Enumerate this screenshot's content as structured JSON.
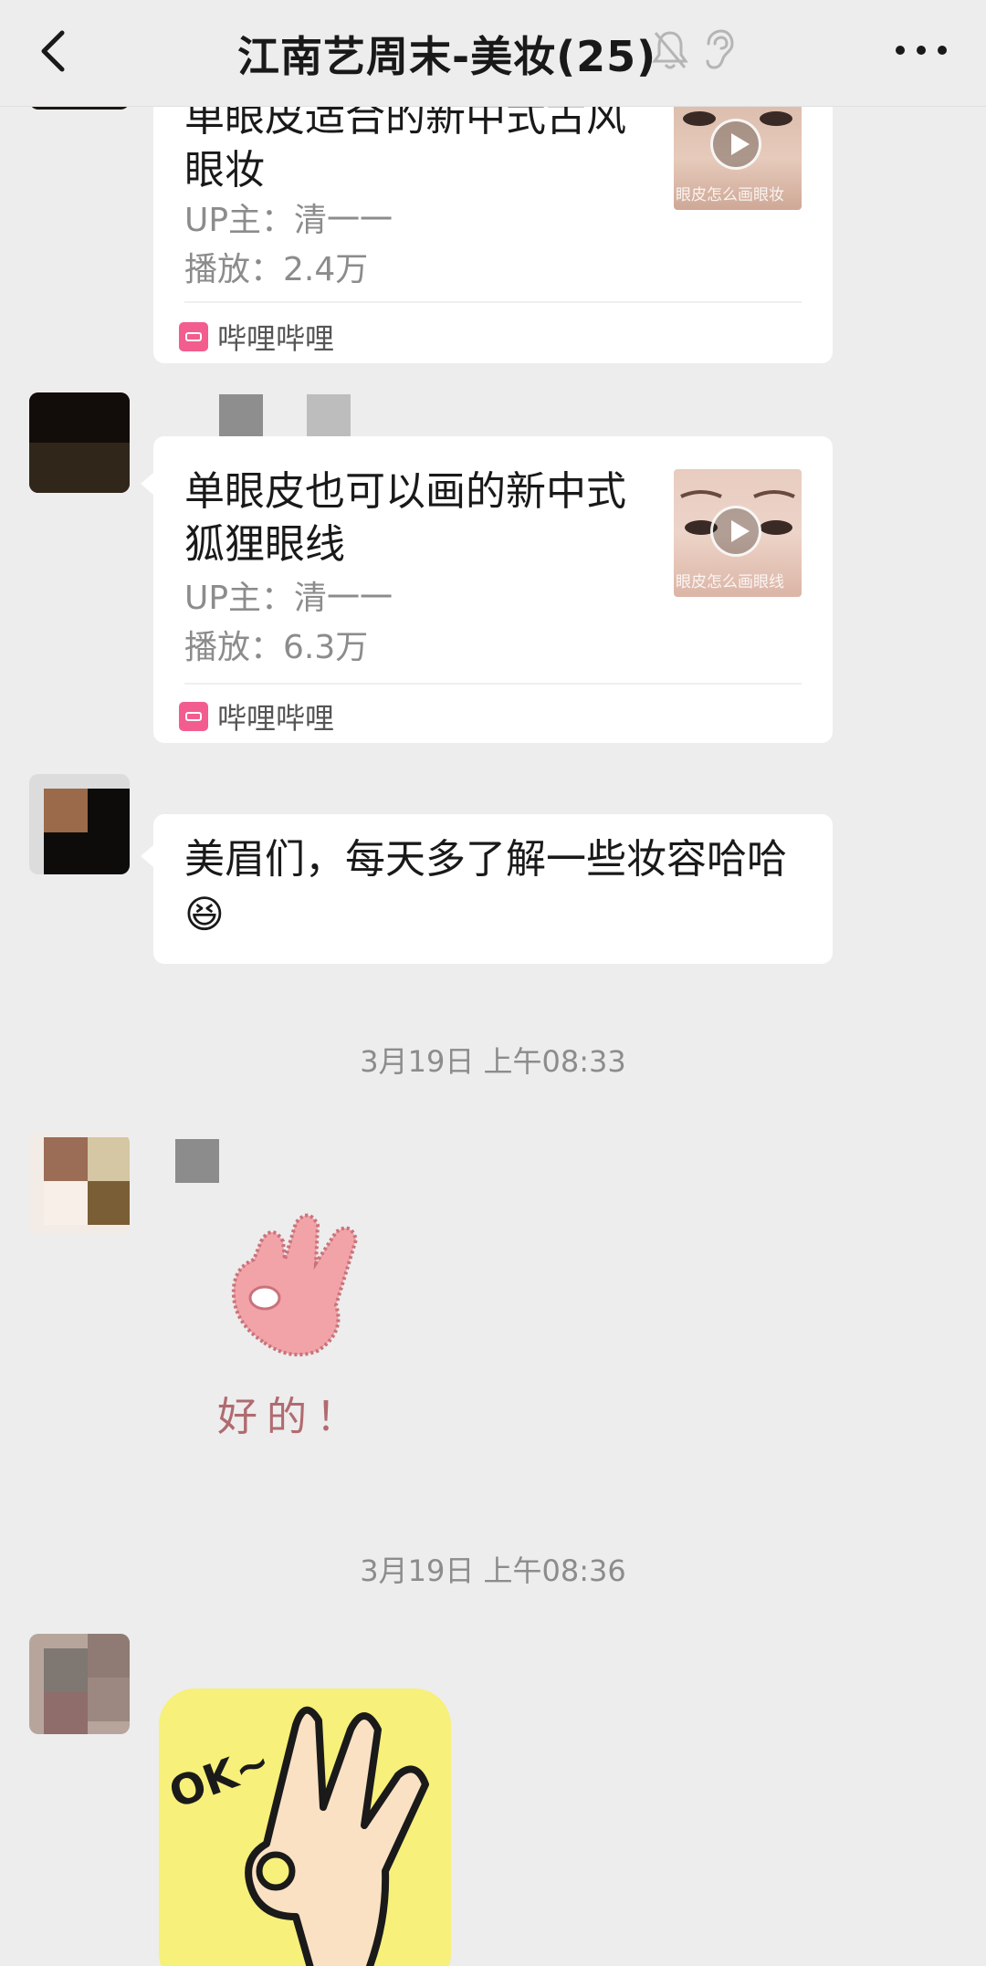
{
  "header": {
    "title": "江南艺周末-美妆(25)",
    "back_icon": "chevron-left-icon",
    "mute_icon": "bell-off-icon",
    "ear_icon": "ear-icon",
    "more_icon": "more-dots-icon"
  },
  "messages": [
    {
      "type": "video_card",
      "title_line1": "单眼皮适合的新中式古风",
      "title_line2": "眼妆",
      "uploader": "UP主：清一一",
      "plays": "播放：2.4万",
      "source": "哔哩哔哩",
      "thumb_caption": "眼皮怎么画眼妆"
    },
    {
      "type": "video_card",
      "title_line1": "单眼皮也可以画的新中式",
      "title_line2": "狐狸眼线",
      "uploader": "UP主：清一一",
      "plays": "播放：6.3万",
      "source": "哔哩哔哩",
      "thumb_caption": "眼皮怎么画眼线"
    },
    {
      "type": "text",
      "line1": "美眉们，每天多了解一些妆容哈哈",
      "emoji": "😆"
    },
    {
      "type": "timestamp",
      "text": "3月19日 上午08:33"
    },
    {
      "type": "sticker",
      "caption": "好的！"
    },
    {
      "type": "timestamp",
      "text": "3月19日 上午08:36"
    },
    {
      "type": "sticker",
      "caption": "OK~"
    }
  ],
  "colors": {
    "background": "#ededed",
    "bubble": "#ffffff",
    "bilibili_pink": "#f25d8e",
    "meta_text": "#8c8c8c"
  }
}
